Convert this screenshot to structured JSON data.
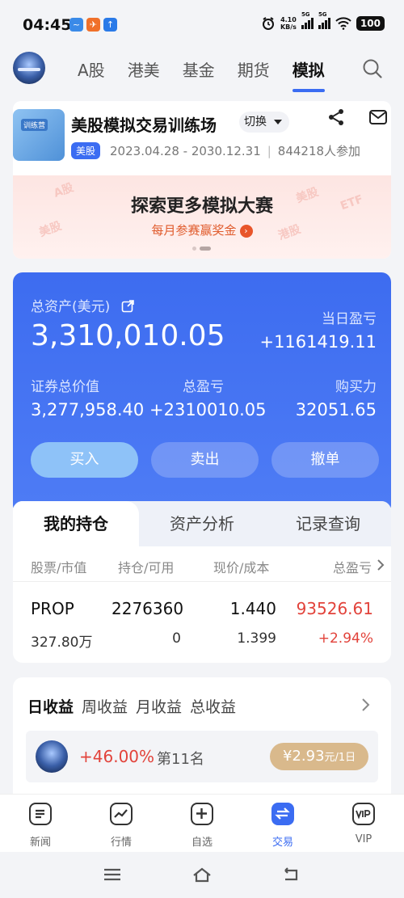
{
  "status_bar": {
    "time": "04:45",
    "net_speed": "4.10",
    "net_unit": "KB/s",
    "sig1": "5G",
    "sig2": "5G",
    "battery": "100"
  },
  "top_nav": {
    "tabs": [
      {
        "label": "A股"
      },
      {
        "label": "港美"
      },
      {
        "label": "基金"
      },
      {
        "label": "期货"
      },
      {
        "label": "模拟",
        "active": true
      }
    ]
  },
  "competition": {
    "logo_text": "训练营",
    "title": "美股模拟交易训练场",
    "switch_label": "切换",
    "market_badge": "美股",
    "date_range": "2023.04.28 - 2030.12.31",
    "participants": "844218人参加"
  },
  "banner": {
    "title": "探索更多模拟大赛",
    "subtitle": "每月参赛赢奖金",
    "deco": [
      "A股",
      "美股",
      "ETF",
      "港股",
      "美股"
    ]
  },
  "assets": {
    "total_label": "总资产(美元)",
    "total_value": "3,310,010.05",
    "daily_pl_label": "当日盈亏",
    "daily_pl_value": "+1161419.11",
    "securities_label": "证券总价值",
    "securities_value": "3,277,958.40",
    "total_pl_label": "总盈亏",
    "total_pl_value": "+2310010.05",
    "buying_power_label": "购买力",
    "buying_power_value": "32051.65",
    "buy_label": "买入",
    "sell_label": "卖出",
    "cancel_label": "撤单"
  },
  "holdings": {
    "tabs": [
      "我的持仓",
      "资产分析",
      "记录查询"
    ],
    "headers": [
      "股票/市值",
      "持仓/可用",
      "现价/成本",
      "总盈亏"
    ],
    "rows": [
      {
        "symbol": "PROP",
        "market_value": "327.80万",
        "position": "2276360",
        "available": "0",
        "price": "1.440",
        "cost": "1.399",
        "pl": "93526.61",
        "pl_pct": "+2.94%"
      }
    ]
  },
  "earnings": {
    "tabs": [
      "日收益",
      "周收益",
      "月收益",
      "总收益"
    ],
    "pct": "+46.00%",
    "rank": "第11名",
    "fee_amount": "¥2.93",
    "fee_unit": "元/1日"
  },
  "bottom_nav": {
    "items": [
      {
        "label": "新闻",
        "icon": "news-icon"
      },
      {
        "label": "行情",
        "icon": "chart-icon"
      },
      {
        "label": "自选",
        "icon": "plus-square-icon"
      },
      {
        "label": "交易",
        "icon": "trade-icon",
        "active": true
      },
      {
        "label": "VIP",
        "icon": "vip-icon"
      }
    ]
  },
  "colors": {
    "accent": "#3b6cf2",
    "red": "#e2433b",
    "gold": "#d9b98c"
  }
}
